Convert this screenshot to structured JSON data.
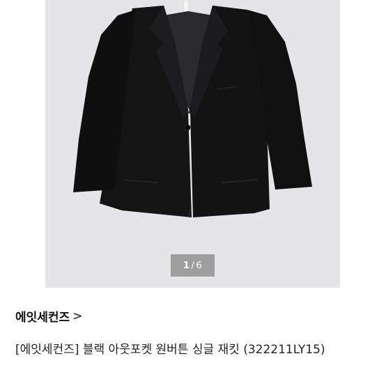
{
  "gallery": {
    "image_alt": "black single-button jacket",
    "pager": {
      "current": "1",
      "separator": "/",
      "total": "6"
    }
  },
  "product": {
    "brand": "에잇세컨즈",
    "brand_chevron": ">",
    "title": "[에잇세컨즈] 블랙 아웃포켓 원버튼 싱글 재킷 (322211LY15)"
  },
  "colors": {
    "gallery_bg": "#e5e5e7",
    "jacket": "#121212",
    "text": "#222222"
  },
  "icons": {
    "chevron": "chevron-right-icon"
  }
}
